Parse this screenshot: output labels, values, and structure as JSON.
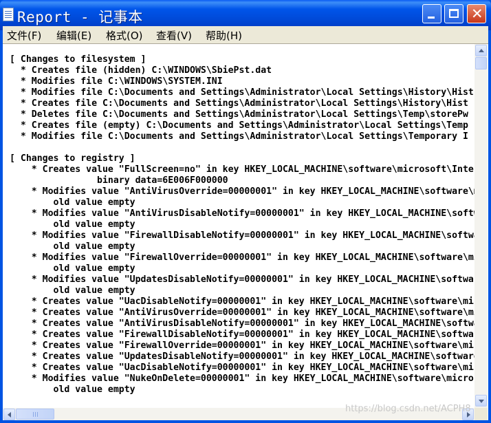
{
  "window": {
    "title": "Report - 记事本"
  },
  "menu": [
    "文件(F)",
    "编辑(E)",
    "格式(O)",
    "查看(V)",
    "帮助(H)"
  ],
  "lines": [
    "[ Changes to filesystem ]",
    "  * Creates file (hidden) C:\\WINDOWS\\SbiePst.dat",
    "  * Modifies file C:\\WINDOWS\\SYSTEM.INI",
    "  * Modifies file C:\\Documents and Settings\\Administrator\\Local Settings\\History\\Hist",
    "  * Creates file C:\\Documents and Settings\\Administrator\\Local Settings\\History\\Hist",
    "  * Deletes file C:\\Documents and Settings\\Administrator\\Local Settings\\Temp\\storePw",
    "  * Creates file (empty) C:\\Documents and Settings\\Administrator\\Local Settings\\Temp",
    "  * Modifies file C:\\Documents and Settings\\Administrator\\Local Settings\\Temporary I",
    "",
    "[ Changes to registry ]",
    "    * Creates value \"FullScreen=no\" in key HKEY_LOCAL_MACHINE\\software\\microsoft\\Inter",
    "                binary data=6E006F000000",
    "    * Modifies value \"AntiVirusOverride=00000001\" in key HKEY_LOCAL_MACHINE\\software\\m",
    "        old value empty",
    "    * Modifies value \"AntiVirusDisableNotify=00000001\" in key HKEY_LOCAL_MACHINE\\softw",
    "        old value empty",
    "    * Modifies value \"FirewallDisableNotify=00000001\" in key HKEY_LOCAL_MACHINE\\softwa",
    "        old value empty",
    "    * Modifies value \"FirewallOverride=00000001\" in key HKEY_LOCAL_MACHINE\\software\\mi",
    "        old value empty",
    "    * Modifies value \"UpdatesDisableNotify=00000001\" in key HKEY_LOCAL_MACHINE\\softwar",
    "        old value empty",
    "    * Creates value \"UacDisableNotify=00000001\" in key HKEY_LOCAL_MACHINE\\software\\mic",
    "    * Creates value \"AntiVirusOverride=00000001\" in key HKEY_LOCAL_MACHINE\\software\\mi",
    "    * Creates value \"AntiVirusDisableNotify=00000001\" in key HKEY_LOCAL_MACHINE\\softwa",
    "    * Creates value \"FirewallDisableNotify=00000001\" in key HKEY_LOCAL_MACHINE\\softwar",
    "    * Creates value \"FirewallOverride=00000001\" in key HKEY_LOCAL_MACHINE\\software\\mic",
    "    * Creates value \"UpdatesDisableNotify=00000001\" in key HKEY_LOCAL_MACHINE\\software",
    "    * Creates value \"UacDisableNotify=00000001\" in key HKEY_LOCAL_MACHINE\\software\\mic",
    "    * Modifies value \"NukeOnDelete=00000001\" in key HKEY_LOCAL_MACHINE\\software\\micros",
    "        old value empty"
  ],
  "watermark": "https://blog.csdn.net/ACPH8",
  "colors": {
    "titlebar": "#0054E3",
    "close_button": "#D9542F",
    "menu_background": "#ECE9D8",
    "editor_background": "#FFFFFF"
  },
  "icons": {
    "app": "notepad-icon",
    "minimize": "minimize-icon",
    "maximize": "maximize-icon",
    "close": "close-icon"
  }
}
